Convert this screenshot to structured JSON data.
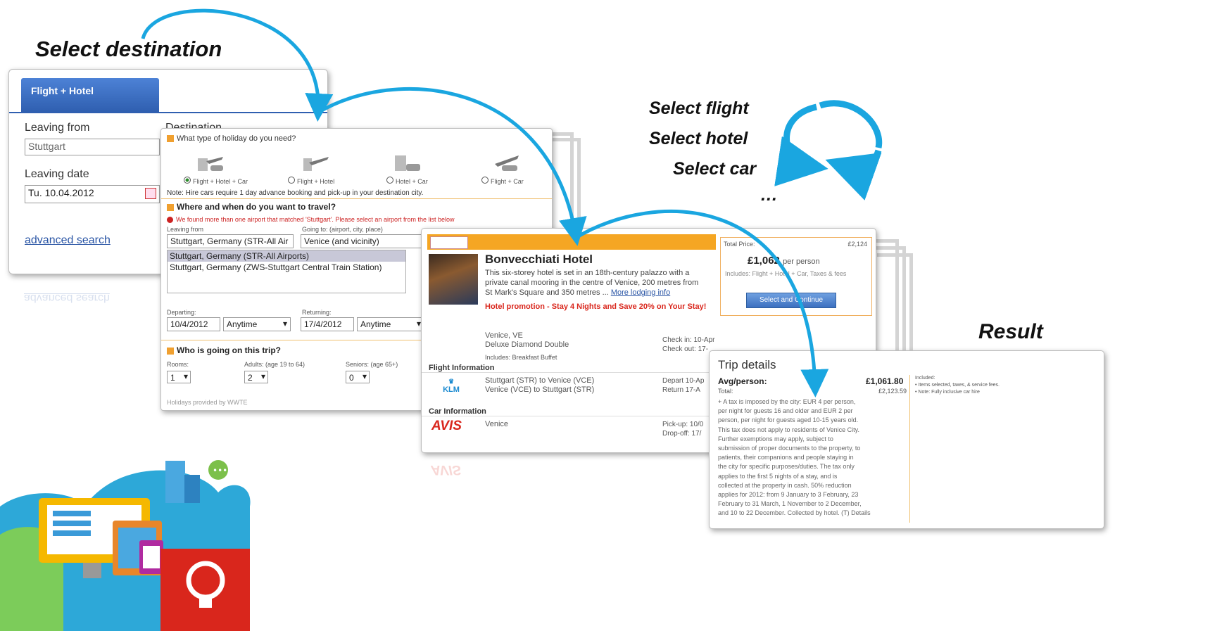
{
  "captions": {
    "select_destination": "Select destination",
    "select_flight": "Select flight",
    "select_hotel": "Select hotel",
    "select_car": "Select car",
    "ellipsis": "…",
    "result": "Result"
  },
  "search_card": {
    "tab": "Flight + Hotel",
    "leaving_from_label": "Leaving from",
    "leaving_from_value": "Stuttgart",
    "destination_label": "Destination",
    "leaving_date_label": "Leaving date",
    "leaving_date_value": "Tu. 10.04.2012",
    "advanced_search": "advanced search"
  },
  "holiday_card": {
    "q1": "What type of holiday do you need?",
    "options": [
      "Flight + Hotel + Car",
      "Flight + Hotel",
      "Hotel + Car",
      "Flight + Car"
    ],
    "note": "Note: Hire cars require 1 day advance booking and pick-up in your destination city.",
    "q2": "Where and when do you want to travel?",
    "warning": "We found more than one airport that matched 'Stuttgart'. Please select an airport from the list below",
    "leaving_from_label": "Leaving from",
    "going_to_label": "Going to: (airport, city, place)",
    "leaving_from_value": "Stuttgart, Germany (STR-All Air",
    "going_to_value": "Venice (and vicinity)",
    "airport_options": [
      "Stuttgart, Germany (STR-All Airports)",
      "Stuttgart, Germany (ZWS-Stuttgart Central Train Station)"
    ],
    "departing_label": "Departing:",
    "returning_label": "Returning:",
    "departing_value": "10/4/2012",
    "returning_value": "17/4/2012",
    "anytime": "Anytime",
    "q3": "Who is going on this trip?",
    "rooms_label": "Rooms:",
    "adults_label": "Adults: (age 19 to 64)",
    "seniors_label": "Seniors: (age 65+)",
    "rooms_value": "1",
    "adults_value": "2",
    "seniors_value": "0",
    "footer": "Holidays provided by WWTE"
  },
  "hotel_card": {
    "name": "Bonvecchiati Hotel",
    "desc_1": "This six-storey hotel is set in an 18th-century palazzo with a",
    "desc_2": "private canal mooring in the centre of Venice, 200 metres from",
    "desc_3": "St Mark's Square and 350 metres ...",
    "more_info": "More lodging info",
    "promo": "Hotel promotion - Stay 4 Nights and Save 20% on Your Stay!",
    "city": "Venice, VE",
    "room": "Deluxe Diamond Double",
    "includes": "Includes: Breakfast Buffet",
    "check_in": "Check in: 10-Apr",
    "check_out": "Check out: 17-",
    "total_price_label": "Total Price:",
    "total_price": "£2,124",
    "per_person_price": "£1,062",
    "per_person_label": "per person",
    "includes_note": "Includes: Flight + Hotel + Car, Taxes & fees",
    "select_button": "Select and Continue",
    "flight_info_label": "Flight Information",
    "flight_1": "Stuttgart (STR) to Venice (VCE)",
    "flight_2": "Venice (VCE) to Stuttgart (STR)",
    "depart": "Depart 10-Ap",
    "return": "Return 17-A",
    "airline": "KLM",
    "car_info_label": "Car Information",
    "car_brand": "AVIS",
    "car_city": "Venice",
    "pickup": "Pick-up: 10/0",
    "dropoff": "Drop-off: 17/"
  },
  "trip_card": {
    "title": "Trip details",
    "avg_label": "Avg/person:",
    "avg_value": "£1,061.80",
    "total_label": "Total:",
    "total_value": "£2,123.59",
    "included_label": "Included:",
    "included_items": [
      "Items selected, taxes, & service fees.",
      "Note: Fully inclusive car hire"
    ],
    "tax_lines": [
      "+ A tax is imposed by the city: EUR 4 per person,",
      "per night for guests 16 and older and EUR 2 per",
      "person, per night for guests aged 10-15 years old.",
      "This tax does not apply to residents of Venice City.",
      "Further exemptions may apply, subject to",
      "submission of proper documents to the property, to",
      "patients, their companions and people staying in",
      "the city for specific purposes/duties. The tax only",
      "applies to the first 5 nights of a stay, and is",
      "collected at the property in cash. 50% reduction",
      "applies for 2012: from 9 January to 3 February, 23",
      "February to 31 March, 1 November to 2 December,",
      "and 10 to 22 December. Collected by hotel. (T) Details"
    ]
  },
  "colors": {
    "arrow": "#1aa6e0",
    "tab_blue": "#3a6fc4",
    "orange": "#f5a623",
    "promo_red": "#d9261c"
  }
}
